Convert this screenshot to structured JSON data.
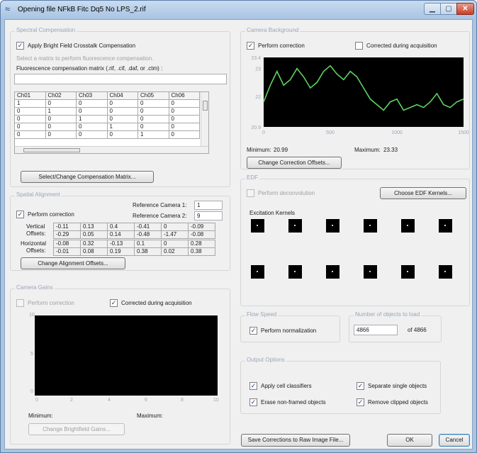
{
  "window": {
    "title": "Opening file NFkB Fitc Dq5 No LPS_2.rif"
  },
  "spectral": {
    "title": "Spectral Compensation",
    "apply_label": "Apply Bright Field Crosstalk Compensation",
    "apply_checked": "✓",
    "hint": "Select a matrix to perform fluorescence compensation.",
    "matrix_label": "Fluorescence compensation matrix (.rif, .cif, .daf, or .ctm) :",
    "matrix_value": "",
    "columns": [
      "Ch01",
      "Ch02",
      "Ch03",
      "Ch04",
      "Ch05",
      "Ch06"
    ],
    "rows": [
      [
        "1",
        "0",
        "0",
        "0",
        "0",
        "0"
      ],
      [
        "0",
        "1",
        "0",
        "0",
        "0",
        "0"
      ],
      [
        "0",
        "0",
        "1",
        "0",
        "0",
        "0"
      ],
      [
        "0",
        "0",
        "0",
        "1",
        "0",
        "0"
      ],
      [
        "0",
        "0",
        "0",
        "0",
        "1",
        "0"
      ]
    ],
    "select_button": "Select/Change Compensation Matrix..."
  },
  "alignment": {
    "title": "Spatial Alignment",
    "perform_label": "Perform correction",
    "perform_checked": "✓",
    "ref_cam1_label": "Reference Camera 1:",
    "ref_cam1_value": "1",
    "ref_cam2_label": "Reference Camera 2:",
    "ref_cam2_value": "9",
    "vertical_label_1": "Vertical",
    "vertical_label_2": "Offsets:",
    "horizontal_label_1": "Horizontal",
    "horizontal_label_2": "Offsets:",
    "vertical_rows": [
      [
        "-0.11",
        "0.13",
        "0.4",
        "-0.41",
        "0",
        "-0.09"
      ],
      [
        "-0.29",
        "0.05",
        "0.14",
        "-0.48",
        "-1.47",
        "-0.08"
      ]
    ],
    "horizontal_rows": [
      [
        "-0.08",
        "0.32",
        "-0.13",
        "0.1",
        "0",
        "0.28"
      ],
      [
        "-0.01",
        "0.08",
        "0.19",
        "0.38",
        "0.02",
        "0.38"
      ]
    ],
    "change_button": "Change Alignment Offsets..."
  },
  "gains": {
    "title": "Camera Gains",
    "perform_label": "Perform correction",
    "corrected_label": "Corrected during acquisition",
    "corrected_checked": "✓",
    "y_ticks": [
      "10",
      "5",
      "0"
    ],
    "x_ticks": [
      "0",
      "2",
      "4",
      "6",
      "8",
      "10"
    ],
    "minimum_label": "Minimum:",
    "maximum_label": "Maximum:",
    "change_button": "Change Brightfield Gains..."
  },
  "background": {
    "title": "Camera Background",
    "perform_label": "Perform correction",
    "perform_checked": "✓",
    "corrected_label": "Corrected during acquisition",
    "minimum_label": "Minimum:",
    "minimum_value": "20.99",
    "maximum_label": "Maximum:",
    "maximum_value": "23.33",
    "change_button": "Change Correction Offsets..."
  },
  "edf": {
    "title": "EDF",
    "deconv_label": "Perform deconvolution",
    "kernels_button": "Choose EDF Kernels...",
    "kernels_label": "Excitation Kernels"
  },
  "flow": {
    "title": "Flow Speed",
    "normalize_label": "Perform normalization",
    "normalize_checked": "✓"
  },
  "objects": {
    "title": "Number of objects to load",
    "value": "4866",
    "of_label": "of 4866"
  },
  "output": {
    "title": "Output Options",
    "apply_classifiers": "Apply cell classifiers",
    "separate_single": "Separate single objects",
    "erase_nonframed": "Erase non-framed objects",
    "remove_clipped": "Remove clipped objects",
    "checked": "✓"
  },
  "footer": {
    "save_button": "Save Corrections to Raw Image File...",
    "ok_button": "OK",
    "cancel_button": "Cancel"
  },
  "colors": {
    "trace": "#5fd35f",
    "plot_bg": "#000000",
    "accent": "#1f3d78"
  },
  "chart_data": {
    "type": "line",
    "title": "",
    "xlabel": "",
    "ylabel": "",
    "xlim": [
      0,
      1500
    ],
    "ylim": [
      20.9,
      23.4
    ],
    "x_ticks": [
      "0",
      "500",
      "1000",
      "1500"
    ],
    "y_ticks": [
      "23.4",
      "23",
      "22",
      "20.9"
    ],
    "grid": false,
    "series": [
      {
        "x": [
          0,
          50,
          100,
          150,
          200,
          250,
          300,
          350,
          400,
          450,
          500,
          550,
          600,
          650,
          700,
          750,
          800,
          850,
          900,
          950,
          1000,
          1050,
          1100,
          1150,
          1200,
          1250,
          1300,
          1350,
          1400,
          1450,
          1500
        ],
        "y": [
          21.8,
          22.4,
          22.9,
          22.4,
          22.6,
          23.0,
          22.7,
          22.3,
          22.5,
          22.9,
          23.1,
          22.8,
          22.6,
          22.9,
          22.7,
          22.3,
          21.9,
          21.7,
          21.5,
          21.8,
          21.9,
          21.5,
          21.6,
          21.7,
          21.6,
          21.8,
          22.1,
          21.7,
          21.6,
          21.8,
          21.9
        ]
      }
    ]
  }
}
